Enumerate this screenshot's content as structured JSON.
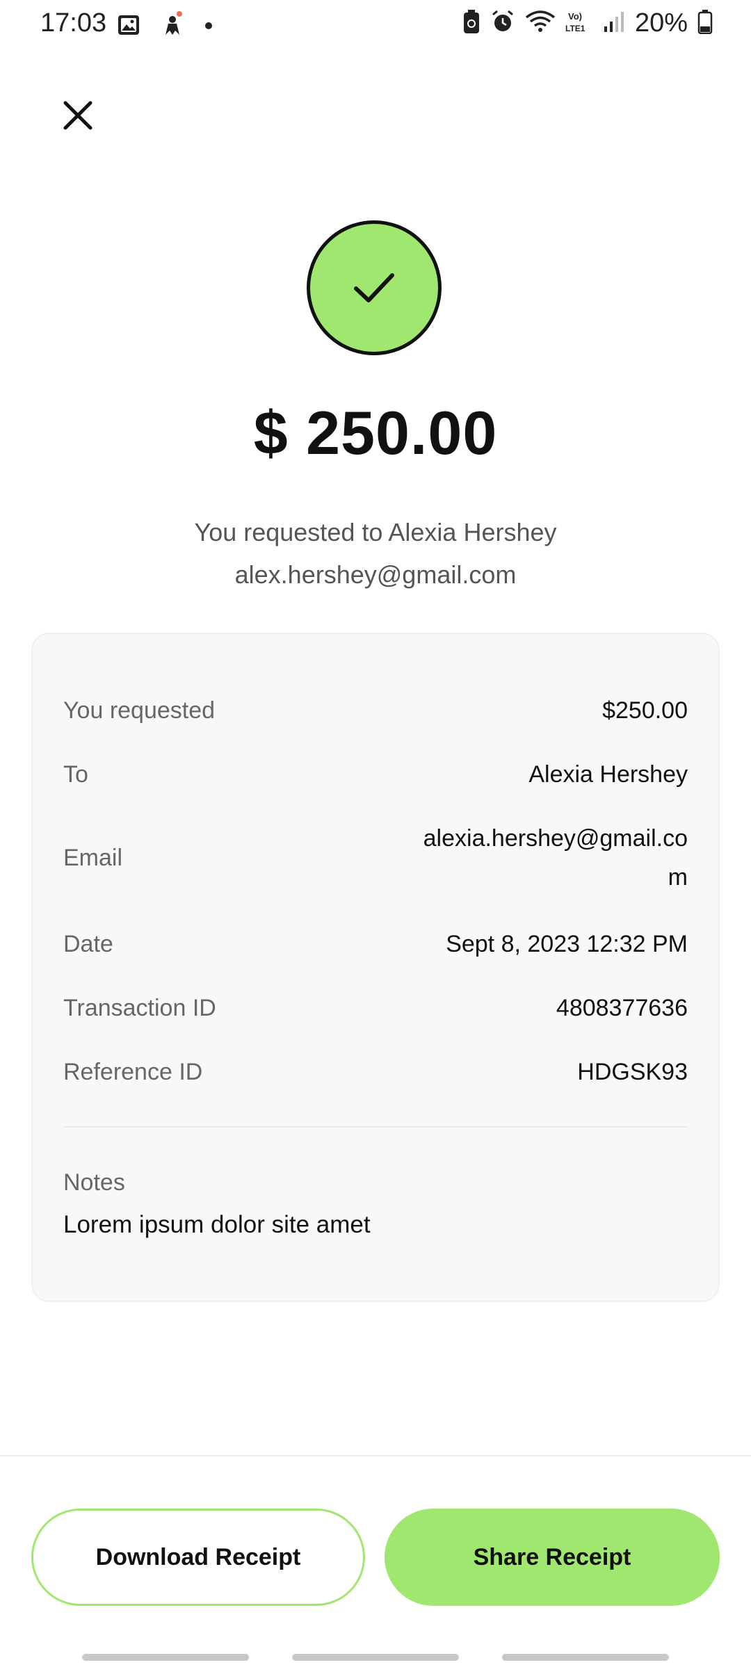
{
  "status_bar": {
    "time": "17:03",
    "battery_percent": "20%",
    "icons": [
      "gallery-icon",
      "notification-dot",
      "person-icon",
      "dot-icon",
      "battery-saver-icon",
      "alarm-icon",
      "wifi-icon",
      "volte-icon",
      "signal-icon",
      "battery-icon"
    ]
  },
  "header": {
    "close_icon": "close-icon"
  },
  "summary": {
    "status_icon": "check-icon",
    "amount": "$ 250.00",
    "line1": "You requested to Alexia Hershey",
    "line2": "alex.hershey@gmail.com"
  },
  "details": {
    "rows": [
      {
        "label": "You requested",
        "value": "$250.00"
      },
      {
        "label": "To",
        "value": "Alexia Hershey"
      },
      {
        "label": "Email",
        "value": "alexia.hershey@gmail.com"
      },
      {
        "label": "Date",
        "value": "Sept 8, 2023 12:32 PM"
      },
      {
        "label": "Transaction ID",
        "value": "4808377636"
      },
      {
        "label": "Reference ID",
        "value": "HDGSK93"
      }
    ],
    "notes_label": "Notes",
    "notes_text": "Lorem ipsum dolor site amet"
  },
  "actions": {
    "download_label": "Download Receipt",
    "share_label": "Share Receipt"
  },
  "colors": {
    "accent": "#a0e76f",
    "card_bg": "#f8f8f8",
    "text": "#111111",
    "muted": "#666666"
  }
}
